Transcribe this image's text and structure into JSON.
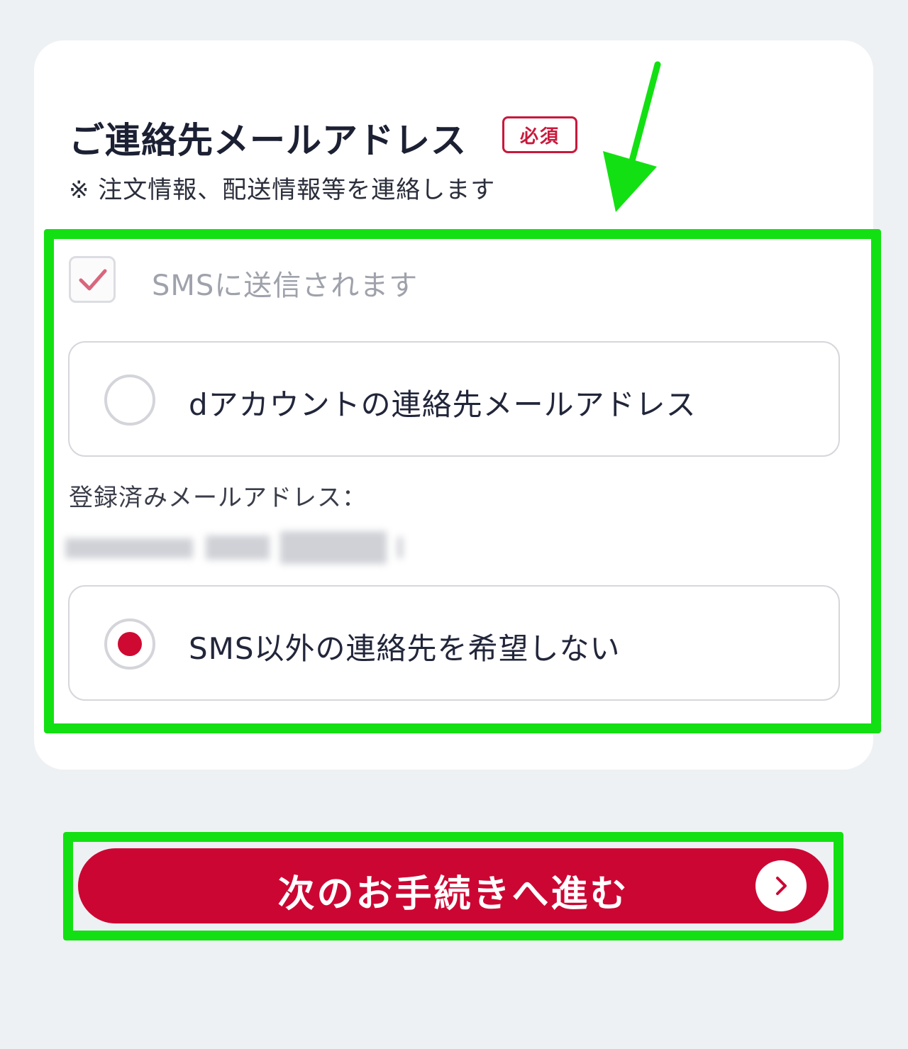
{
  "section": {
    "title": "ご連絡先メールアドレス",
    "required_badge": "必須",
    "note": "※ 注文情報、配送情報等を連絡します"
  },
  "sms_checkbox": {
    "label": "SMSに送信されます",
    "checked": true
  },
  "options": [
    {
      "label": "dアカウントの連絡先メールアドレス",
      "selected": false
    },
    {
      "label": "SMS以外の連絡先を希望しない",
      "selected": true
    }
  ],
  "registered_email": {
    "label": "登録済みメールアドレス："
  },
  "next_button": {
    "label": "次のお手続きへ進む"
  },
  "colors": {
    "accent": "#cc0633",
    "highlight": "#13e012",
    "background": "#eef1f3"
  },
  "icons": {
    "checkbox": "check-icon",
    "next": "chevron-right-icon",
    "annotation": "arrow-down-icon"
  }
}
